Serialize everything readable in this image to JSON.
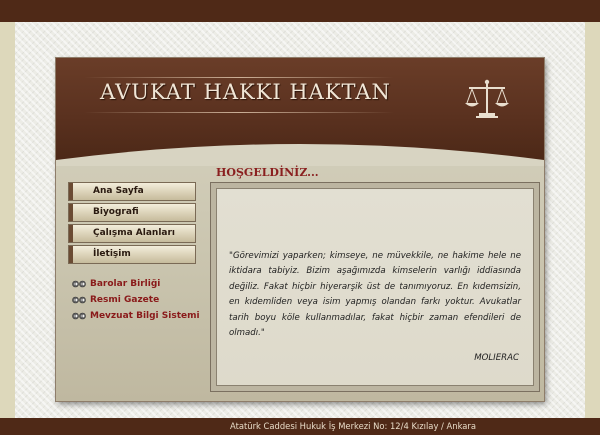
{
  "header": {
    "title": "AVUKAT HAKKI HAKTAN",
    "logo_icon": "scales-of-justice-icon"
  },
  "welcome": "HOŞGELDİNİZ...",
  "nav": {
    "items": [
      {
        "label": "Ana Sayfa"
      },
      {
        "label": "Biyografi"
      },
      {
        "label": "Çalışma Alanları"
      },
      {
        "label": "İletişim"
      }
    ]
  },
  "links": {
    "icon": "arrow-links-icon",
    "items": [
      {
        "label": "Barolar Birliği"
      },
      {
        "label": "Resmi Gazete"
      },
      {
        "label": "Mevzuat Bilgi Sistemi"
      }
    ]
  },
  "content": {
    "quote": "\"Görevimizi yaparken; kimseye, ne müvekkile, ne hakime hele ne iktidara tabiyiz. Bizim aşağımızda kimselerin varlığı iddiasında değiliz. Fakat hiçbir hiyerarşik üst de tanımıyoruz. En kıdemsizin, en kıdemliden veya isim yapmış olandan farkı yoktur. Avukatlar tarih boyu köle kullanmadılar, fakat hiçbir zaman efendileri de olmadı.\"",
    "author": "MOLIERAC"
  },
  "footer": {
    "address": "Atatürk Caddesi Hukuk İş Merkezi No: 12/4 Kızılay / Ankara"
  },
  "colors": {
    "brown_header": "#5a311f",
    "dark_brown": "#4f2917",
    "accent_red": "#8a1f1f",
    "page_bg": "#e6e2c8"
  }
}
